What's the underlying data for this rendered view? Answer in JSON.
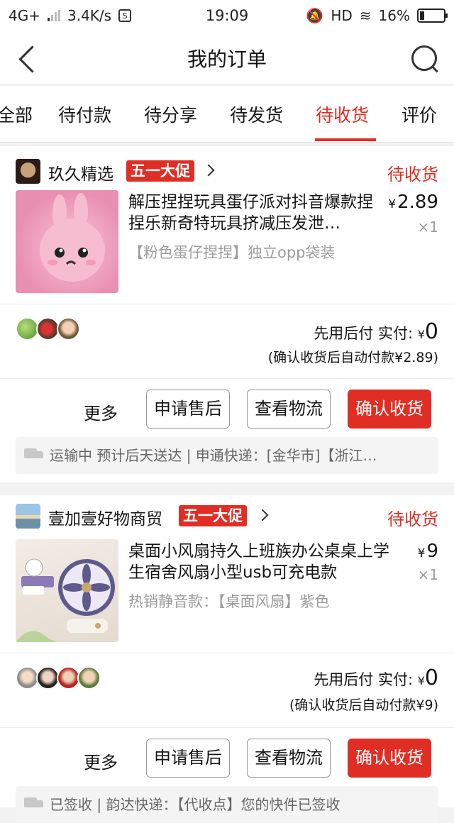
{
  "status_bar": {
    "network": "4G+",
    "speed": "3.4K/s",
    "sim_icon_text": "S",
    "time": "19:09",
    "hd": "HD",
    "battery": "16%"
  },
  "nav": {
    "title": "我的订单"
  },
  "tabs": [
    {
      "label": "全部"
    },
    {
      "label": "待付款"
    },
    {
      "label": "待分享"
    },
    {
      "label": "待发货"
    },
    {
      "label": "待收货"
    },
    {
      "label": "评价"
    }
  ],
  "active_tab": "待收货",
  "orders": [
    {
      "shop_name": "玖久精选",
      "promo": "五一大促",
      "status": "待收货",
      "title": "解压捏捏玩具蛋仔派对抖音爆款捏捏乐新奇特玩具挤减压发泄…",
      "spec": "【粉色蛋仔捏捏】独立opp袋装",
      "currency": "¥",
      "price": "2.89",
      "qty": "×1",
      "pay_label": "先用后付 实付:",
      "paid_currency": "¥",
      "paid_amount": "0",
      "pay_note": "(确认收货后自动付款¥2.89)",
      "more": "更多",
      "btn_after_sale": "申请售后",
      "btn_logistics": "查看物流",
      "btn_confirm": "确认收货",
      "logistics": "运输中 预计后天送达 | 申通快递：[金华市]【浙江…"
    },
    {
      "shop_name": "壹加壹好物商贸",
      "promo": "五一大促",
      "status": "待收货",
      "title": "桌面小风扇持久上班族办公桌桌上学生宿舍风扇小型usb可充电款",
      "spec": "热销静音款：【桌面风扇】紫色",
      "currency": "¥",
      "price": "9",
      "qty": "×1",
      "pay_label": "先用后付 实付:",
      "paid_currency": "¥",
      "paid_amount": "0",
      "pay_note": "(确认收货后自动付款¥9)",
      "more": "更多",
      "btn_after_sale": "申请售后",
      "btn_logistics": "查看物流",
      "btn_confirm": "确认收货",
      "logistics": "已签收 | 韵达快递：【代收点】您的快件已签收"
    }
  ],
  "colors": {
    "accent": "#e02e24",
    "muted": "#9c9c9c",
    "text": "#151516"
  },
  "icons": [
    "back-icon",
    "search-icon",
    "chevron-right-icon",
    "truck-icon"
  ]
}
